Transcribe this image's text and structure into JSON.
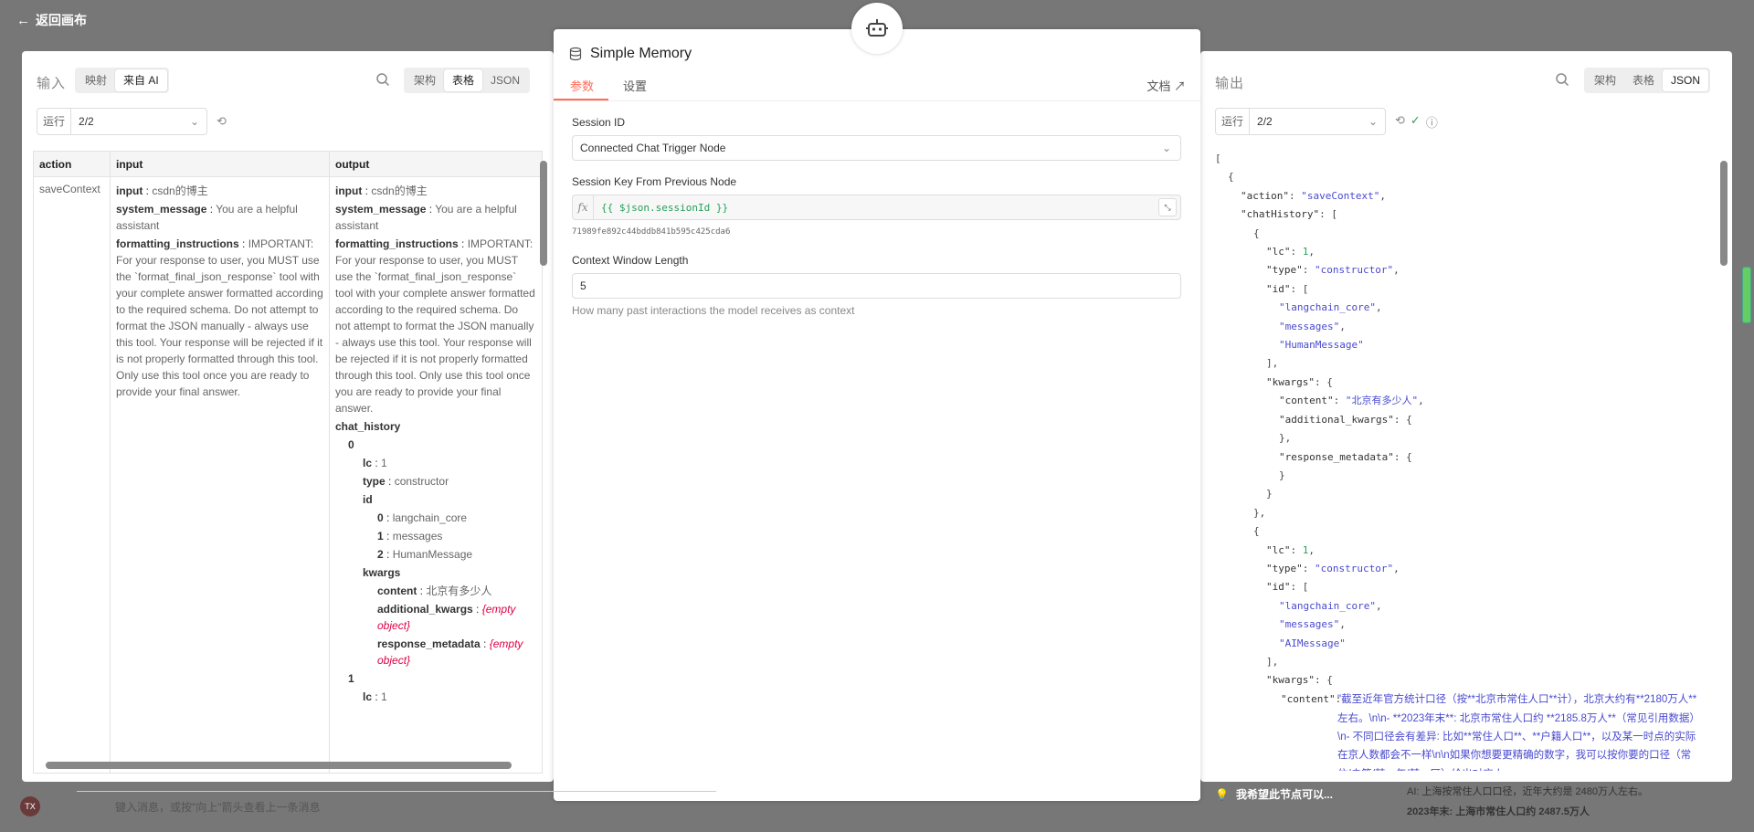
{
  "topbar": {
    "back_label": "返回画布"
  },
  "left": {
    "label": "输入",
    "mode_tabs": [
      "映射",
      "来自 AI"
    ],
    "mode_active": 1,
    "view_tabs": [
      "架构",
      "表格",
      "JSON"
    ],
    "view_active": 1,
    "run_label": "运行",
    "run_value": "2/2",
    "columns": [
      "action",
      "input",
      "output"
    ],
    "row": {
      "action": "saveContext",
      "input": {
        "input_key": "input",
        "input_val": "csdn的博主",
        "sys_key": "system_message",
        "sys_val": "You are a helpful assistant",
        "fmt_key": "formatting_instructions",
        "fmt_val": "IMPORTANT: For your response to user, you MUST use the `format_final_json_response` tool with your complete answer formatted according to the required schema. Do not attempt to format the JSON manually - always use this tool. Your response will be rejected if it is not properly formatted through this tool. Only use this tool once you are ready to provide your final answer."
      },
      "output": {
        "input_key": "input",
        "input_val": "csdn的博主",
        "sys_key": "system_message",
        "sys_val": "You are a helpful assistant",
        "fmt_key": "formatting_instructions",
        "fmt_val": "IMPORTANT: For your response to user, you MUST use the `format_final_json_response` tool with your complete answer formatted according to the required schema. Do not attempt to format the JSON manually - always use this tool. Your response will be rejected if it is not properly formatted through this tool. Only use this tool once you are ready to provide your final answer.",
        "chat_history_key": "chat_history",
        "idx0": "0",
        "lc_key": "lc",
        "lc_val": "1",
        "type_key": "type",
        "type_val": "constructor",
        "id_key": "id",
        "id0_key": "0",
        "id0_val": "langchain_core",
        "id1_key": "1",
        "id1_val": "messages",
        "id2_key": "2",
        "id2_val": "HumanMessage",
        "kwargs_key": "kwargs",
        "content_key": "content",
        "content_val": "北京有多少人",
        "add_key": "additional_kwargs",
        "add_val": "{empty object}",
        "resp_key": "response_metadata",
        "resp_val": "{empty object}",
        "idx1": "1",
        "lc2_key": "lc",
        "lc2_val": "1"
      }
    }
  },
  "center": {
    "title": "Simple Memory",
    "tabs": [
      "参数",
      "设置"
    ],
    "tab_active": 0,
    "doc_label": "文档",
    "session_id_label": "Session ID",
    "session_id_value": "Connected Chat Trigger Node",
    "session_key_label": "Session Key From Previous Node",
    "session_key_expr": "{{ $json.sessionId }}",
    "session_key_result": "71989fe892c44bddb841b595c425cda6",
    "context_label": "Context Window Length",
    "context_value": "5",
    "context_hint": "How many past interactions the model receives as context"
  },
  "right": {
    "label": "输出",
    "view_tabs": [
      "架构",
      "表格",
      "JSON"
    ],
    "view_active": 2,
    "run_label": "运行",
    "run_value": "2/2",
    "json_lines": [
      {
        "t": "[",
        "i": 0
      },
      {
        "t": "{",
        "i": 1
      },
      {
        "k": "\"action\"",
        "s": "\"saveContext\"",
        "e": ",",
        "i": 2
      },
      {
        "k": "\"chatHistory\"",
        "p": "[",
        "i": 2
      },
      {
        "t": "{",
        "i": 3
      },
      {
        "k": "\"lc\"",
        "n": "1",
        "e": ",",
        "i": 4
      },
      {
        "k": "\"type\"",
        "s": "\"constructor\"",
        "e": ",",
        "i": 4
      },
      {
        "k": "\"id\"",
        "p": "[",
        "i": 4
      },
      {
        "s": "\"langchain_core\"",
        "e": ",",
        "i": 5
      },
      {
        "s": "\"messages\"",
        "e": ",",
        "i": 5
      },
      {
        "s": "\"HumanMessage\"",
        "i": 5
      },
      {
        "t": "],",
        "i": 4
      },
      {
        "k": "\"kwargs\"",
        "p": "{",
        "i": 4
      },
      {
        "k": "\"content\"",
        "s": "\"北京有多少人\"",
        "e": ",",
        "i": 5
      },
      {
        "k": "\"additional_kwargs\"",
        "p": "{",
        "i": 5
      },
      {
        "t": "},",
        "i": 5
      },
      {
        "k": "\"response_metadata\"",
        "p": "{",
        "i": 5
      },
      {
        "t": "}",
        "i": 5
      },
      {
        "t": "}",
        "i": 4
      },
      {
        "t": "},",
        "i": 3
      },
      {
        "t": "{",
        "i": 3
      },
      {
        "k": "\"lc\"",
        "n": "1",
        "e": ",",
        "i": 4
      },
      {
        "k": "\"type\"",
        "s": "\"constructor\"",
        "e": ",",
        "i": 4
      },
      {
        "k": "\"id\"",
        "p": "[",
        "i": 4
      },
      {
        "s": "\"langchain_core\"",
        "e": ",",
        "i": 5
      },
      {
        "s": "\"messages\"",
        "e": ",",
        "i": 5
      },
      {
        "s": "\"AIMessage\"",
        "i": 5
      },
      {
        "t": "],",
        "i": 4
      },
      {
        "k": "\"kwargs\"",
        "p": "{",
        "i": 4
      }
    ],
    "ai_content_key": "\"content\"",
    "ai_content": "\"截至近年官方统计口径（按**北京市常住人口**计），北京大约有**2180万人**左右。\\n\\n- **2023年末**: 北京市常住人口约 **2185.8万人**（常见引用数据）\\n- 不同口径会有差异: 比如**常住人口**、**户籍人口**，以及某一时点的实际在京人数都会不一样\\n\\n如果你想要更精确的数字，我可以按你要的口径（常住/户籍/某一年/某一区）给出对应人"
  },
  "bottom": {
    "chat_placeholder": "键入消息，或按\"向上\"箭头查看上一条消息",
    "toast": "我希望此节点可以...",
    "bg_note_a": "AI: 上海按常住人口口径，近年大约是 2480万人左右。",
    "bg_note_b": "2023年末: 上海市常住人口约 2487.5万人",
    "avatar_text": "TX"
  }
}
